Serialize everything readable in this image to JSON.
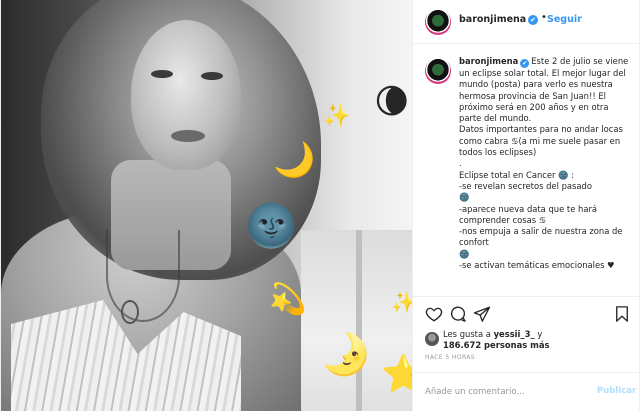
{
  "header": {
    "username": "baronjimena",
    "verified_mark": "✔",
    "separator": "•",
    "follow_label": "Seguir"
  },
  "post": {
    "photo": {
      "emojis": [
        "🌘",
        "✨",
        "🌙",
        "🌚",
        "💫",
        "🌛",
        "⭐",
        "✨"
      ]
    },
    "caption": {
      "username": "baronjimena",
      "text": "Este 2 de julio se viene un eclipse solar total. El mejor lugar del mundo (posta) para verlo es nuestra hermosa provincia de San Juan!! El próximo será en 200 años y en otra parte del mundo.\nDatos importantes para no andar locas como cabra ♋(a mi me suele pasar en todos los eclipses)\n.\nEclipse total en Cancer 🌚 :\n-se revelan secretos del pasado\n🌚\n-aparece nueva data que te hará comprender cosas ♋\n-nos empuja a salir de nuestra zona de confort\n🌚\n-se activan temáticas emocionales ♥"
    }
  },
  "likes": {
    "prefix": "Les gusta a",
    "user": "yessii_3_",
    "conjunction": "y",
    "count": "186.672 personas más"
  },
  "timestamp": "HACE 5 HORAS",
  "comment": {
    "placeholder": "Añade un comentario...",
    "submit_label": "Publicar"
  },
  "colors": {
    "link_blue": "#3897f0",
    "publish_disabled": "#b2dffc",
    "border": "#efefef",
    "muted": "#999999"
  },
  "icons": {
    "like": "heart-icon",
    "comment": "comment-icon",
    "share": "share-icon",
    "save": "bookmark-icon"
  }
}
